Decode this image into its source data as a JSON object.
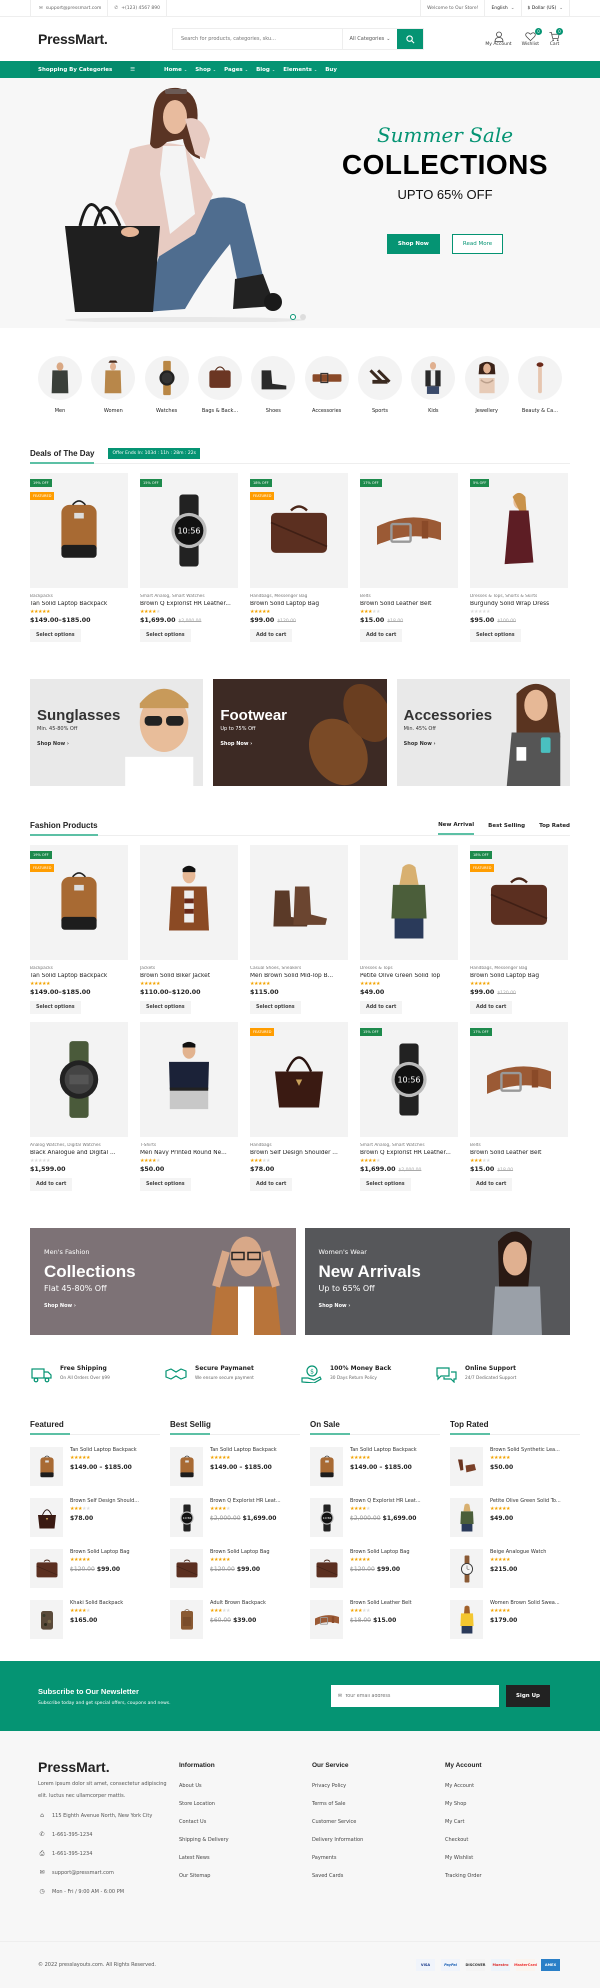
{
  "topbar": {
    "email": "support@pressmart.com",
    "phone": "+(123) 4567 890",
    "welcome": "Welcome to Our Store!",
    "language": "English",
    "currency": "$ Dollar (US)"
  },
  "header": {
    "logo": "PressMart.",
    "search_placeholder": "Search for products, categories, sku...",
    "category_select": "All Categories",
    "account_label": "My Account",
    "wishlist_label": "Wishlist",
    "wishlist_count": "0",
    "cart_label": "Cart",
    "cart_count": "0"
  },
  "nav": {
    "categories_label": "Shopping By Categories",
    "items": [
      {
        "label": "Home",
        "dropdown": true
      },
      {
        "label": "Shop",
        "dropdown": true
      },
      {
        "label": "Pages",
        "dropdown": true
      },
      {
        "label": "Blog",
        "dropdown": true
      },
      {
        "label": "Elements",
        "dropdown": true
      },
      {
        "label": "Buy",
        "dropdown": false
      }
    ]
  },
  "hero": {
    "script": "Summer Sale",
    "title": "COLLECTIONS",
    "subtitle": "UPTO 65% OFF",
    "primary_button": "Shop Now",
    "secondary_button": "Read More",
    "slides": 2,
    "active_slide": 1
  },
  "categories": [
    {
      "label": "Men",
      "icon": "shirt"
    },
    {
      "label": "Women",
      "icon": "coat"
    },
    {
      "label": "Watches",
      "icon": "watch"
    },
    {
      "label": "Bags & Back...",
      "icon": "bag"
    },
    {
      "label": "Shoes",
      "icon": "boot"
    },
    {
      "label": "Accessories",
      "icon": "belt"
    },
    {
      "label": "Sports",
      "icon": "pushup-bar"
    },
    {
      "label": "Kids",
      "icon": "kid-jacket"
    },
    {
      "label": "Jewellery",
      "icon": "necklace"
    },
    {
      "label": "Beauty & Ca...",
      "icon": "brush"
    }
  ],
  "deals": {
    "title": "Deals of The Day",
    "offer": "Offer Ends In:  103d : 11h : 28m : 22s",
    "products": [
      {
        "category": "Backpacks",
        "name": "Tan Solid Laptop Backpack",
        "rating": 5,
        "price": "$149.00–$185.00",
        "old_price": "",
        "discount": "19% OFF",
        "featured": true,
        "cta": "Select options",
        "img": "backpack"
      },
      {
        "category": "Smart Analog, Smart Watches",
        "name": "Brown Q Explorist HR Leather...",
        "rating": 4,
        "price": "$1,699.00",
        "old_price": "$2,000.00",
        "discount": "15% OFF",
        "featured": false,
        "cta": "Select options",
        "img": "smartwatch"
      },
      {
        "category": "Handbags, Messenger Bag",
        "name": "Brown Solid Laptop Bag",
        "rating": 5,
        "price": "$99.00",
        "old_price": "$120.00",
        "discount": "18% OFF",
        "featured": true,
        "cta": "Add to cart",
        "img": "laptopbag"
      },
      {
        "category": "Belts",
        "name": "Brown Solid Leather Belt",
        "rating": 3,
        "price": "$15.00",
        "old_price": "$18.00",
        "discount": "17% OFF",
        "featured": false,
        "cta": "Add to cart",
        "img": "belt"
      },
      {
        "category": "Dresses & Tops, Shorts & Skirts",
        "name": "Burgundy Solid Wrap Dress",
        "rating": 0,
        "price": "$95.00",
        "old_price": "$100.00",
        "discount": "5% OFF",
        "featured": false,
        "cta": "Select options",
        "img": "dress"
      }
    ]
  },
  "promo_banners": [
    {
      "title": "Sunglasses",
      "subtitle": "Min. 45-80% Off",
      "link": "Shop Now",
      "theme": "light"
    },
    {
      "title": "Footwear",
      "subtitle": "Up to 75% Off",
      "link": "Shop Now",
      "theme": "dark"
    },
    {
      "title": "Accessories",
      "subtitle": "Min. 45% Off",
      "link": "Shop Now",
      "theme": "light"
    }
  ],
  "fashion": {
    "title": "Fashion Products",
    "tabs": [
      "New Arrival",
      "Best Selling",
      "Top Rated"
    ],
    "active_tab": 0,
    "products": [
      {
        "category": "Backpacks",
        "name": "Tan Solid Laptop Backpack",
        "rating": 5,
        "price": "$149.00–$185.00",
        "old_price": "",
        "discount": "19% OFF",
        "featured": true,
        "cta": "Select options",
        "img": "backpack"
      },
      {
        "category": "Jackets",
        "name": "Brown Solid Biker Jacket",
        "rating": 5,
        "price": "$110.00–$120.00",
        "old_price": "",
        "discount": "",
        "featured": false,
        "cta": "Select options",
        "img": "jacket"
      },
      {
        "category": "Casual Shoes, Sneakers",
        "name": "Men Brown Solid Mid-Top B...",
        "rating": 5,
        "price": "$115.00",
        "old_price": "",
        "discount": "",
        "featured": false,
        "cta": "Select options",
        "img": "boots"
      },
      {
        "category": "Dresses & Tops",
        "name": "Petite Olive Green Solid Top",
        "rating": 5,
        "price": "$49.00",
        "old_price": "",
        "discount": "",
        "featured": false,
        "cta": "Add to cart",
        "img": "top"
      },
      {
        "category": "Handbags, Messenger Bag",
        "name": "Brown Solid Laptop Bag",
        "rating": 5,
        "price": "$99.00",
        "old_price": "$120.00",
        "discount": "18% OFF",
        "featured": true,
        "cta": "Add to cart",
        "img": "laptopbag"
      },
      {
        "category": "Analog Watches, Digital Watches",
        "name": "Black Analogue and Digital ...",
        "rating": 0,
        "price": "$1,599.00",
        "old_price": "",
        "discount": "",
        "featured": false,
        "cta": "Add to cart",
        "img": "digiwatch"
      },
      {
        "category": "T-Shirts",
        "name": "Men Navy Printed Round Ne...",
        "rating": 4,
        "price": "$50.00",
        "old_price": "",
        "discount": "",
        "featured": false,
        "cta": "Select options",
        "img": "tshirt"
      },
      {
        "category": "Handbags",
        "name": "Brown Self Design Shoulder ...",
        "rating": 3,
        "price": "$78.00",
        "old_price": "",
        "discount": "",
        "featured": true,
        "cta": "Add to cart",
        "img": "handbag"
      },
      {
        "category": "Smart Analog, Smart Watches",
        "name": "Brown Q Explorist HR Leather...",
        "rating": 4,
        "price": "$1,699.00",
        "old_price": "$2,000.00",
        "discount": "15% OFF",
        "featured": false,
        "cta": "Select options",
        "img": "smartwatch"
      },
      {
        "category": "Belts",
        "name": "Brown Solid Leather Belt",
        "rating": 3,
        "price": "$15.00",
        "old_price": "$18.00",
        "discount": "17% OFF",
        "featured": false,
        "cta": "Add to cart",
        "img": "belt"
      }
    ]
  },
  "wide_banners": [
    {
      "small": "Men's Fashion",
      "title": "Collections",
      "subtitle": "Flat 45-80% Off",
      "link": "Shop Now"
    },
    {
      "small": "Women's Wear",
      "title": "New Arrivals",
      "subtitle": "Up to 65% Off",
      "link": "Shop Now"
    }
  ],
  "features": [
    {
      "icon": "truck",
      "title": "Free Shipping",
      "text": "On All Orders Over $99"
    },
    {
      "icon": "handshake",
      "title": "Secure Paymanet",
      "text": "We ensure secure payment"
    },
    {
      "icon": "money-back",
      "title": "100% Money Back",
      "text": "30 Days Return Policy"
    },
    {
      "icon": "chat",
      "title": "Online Support",
      "text": "24/7 Dedicated Support"
    }
  ],
  "lists": [
    {
      "title": "Featured",
      "items": [
        {
          "name": "Tan Solid Laptop Backpack",
          "rating": 5,
          "old_price": "",
          "price": "$149.00 – $185.00",
          "img": "backpack"
        },
        {
          "name": "Brown Self Design Should...",
          "rating": 3,
          "old_price": "",
          "price": "$78.00",
          "img": "handbag"
        },
        {
          "name": "Brown Solid Laptop Bag",
          "rating": 5,
          "old_price": "$120.00",
          "price": "$99.00",
          "img": "laptopbag"
        },
        {
          "name": "Khaki Solid Backpack",
          "rating": 4,
          "old_price": "",
          "price": "$165.00",
          "img": "camo"
        }
      ]
    },
    {
      "title": "Best Sellig",
      "items": [
        {
          "name": "Tan Solid Laptop Backpack",
          "rating": 5,
          "old_price": "",
          "price": "$149.00 – $185.00",
          "img": "backpack"
        },
        {
          "name": "Brown Q Explorist HR Leat...",
          "rating": 4,
          "old_price": "$2,000.00",
          "price": "$1,699.00",
          "img": "smartwatch"
        },
        {
          "name": "Brown Solid Laptop Bag",
          "rating": 5,
          "old_price": "$120.00",
          "price": "$99.00",
          "img": "laptopbag"
        },
        {
          "name": "Adult Brown Backpack",
          "rating": 3,
          "old_price": "$60.00",
          "price": "$39.00",
          "img": "brownpack"
        }
      ]
    },
    {
      "title": "On Sale",
      "items": [
        {
          "name": "Tan Solid Laptop Backpack",
          "rating": 5,
          "old_price": "",
          "price": "$149.00 – $185.00",
          "img": "backpack"
        },
        {
          "name": "Brown Q Explorist HR Leat...",
          "rating": 4,
          "old_price": "$2,000.00",
          "price": "$1,699.00",
          "img": "smartwatch"
        },
        {
          "name": "Brown Solid Laptop Bag",
          "rating": 5,
          "old_price": "$120.00",
          "price": "$99.00",
          "img": "laptopbag"
        },
        {
          "name": "Brown Solid Leather Belt",
          "rating": 3,
          "old_price": "$18.00",
          "price": "$15.00",
          "img": "belt"
        }
      ]
    },
    {
      "title": "Top Rated",
      "items": [
        {
          "name": "Brown Solid Synthetic Lea...",
          "rating": 5,
          "old_price": "",
          "price": "$50.00",
          "img": "shoes"
        },
        {
          "name": "Petite Olive Green Solid To...",
          "rating": 5,
          "old_price": "",
          "price": "$49.00",
          "img": "top"
        },
        {
          "name": "Beige Analogue Watch",
          "rating": 5,
          "old_price": "",
          "price": "$215.00",
          "img": "analog"
        },
        {
          "name": "Women Brown Solid Swea...",
          "rating": 5,
          "old_price": "",
          "price": "$179.00",
          "img": "yellowtop"
        }
      ]
    }
  ],
  "newsletter": {
    "title": "Subscribe to Our Newsletter",
    "text": "Subscribe today and get special offers, coupons and news.",
    "placeholder": "Your email address",
    "button": "Sign Up"
  },
  "footer": {
    "logo": "PressMart.",
    "description": "Lorem ipsum dolor sit amet, consectetur adipiscing elit. luctus nec ullamcorper mattis.",
    "address": "115 Eighth Avenue North, New York City",
    "phone": "1-661-395-1234",
    "fax": "1-661-395-1234",
    "email": "support@pressmart.com",
    "hours": "Mon - Fri / 9:00 AM - 6:00 PM",
    "columns": [
      {
        "title": "Information",
        "links": [
          "About Us",
          "Store Location",
          "Contact Us",
          "Shipping & Delivery",
          "Latest News",
          "Our Sitemap"
        ]
      },
      {
        "title": "Our Service",
        "links": [
          "Privacy Policy",
          "Terms of Sale",
          "Customer Service",
          "Delivery Information",
          "Payments",
          "Saved Cards"
        ]
      },
      {
        "title": "My Account",
        "links": [
          "My Account",
          "My Shop",
          "My Cart",
          "Checkout",
          "My Wishlist",
          "Tracking Order"
        ]
      }
    ],
    "copyright": "© 2022 presslayouts.com. All Rights Reserved.",
    "payments": [
      "VISA",
      "PayPal",
      "DISCOVER",
      "Maestro",
      "MasterCard",
      "AMEX"
    ]
  },
  "colors": {
    "brand": "#059473",
    "brand_light": "#5cc0a5",
    "discount_tag": "#1d8a4c",
    "featured_tag": "#ff9d00",
    "star": "#f3a300",
    "dark_button": "#222222"
  }
}
